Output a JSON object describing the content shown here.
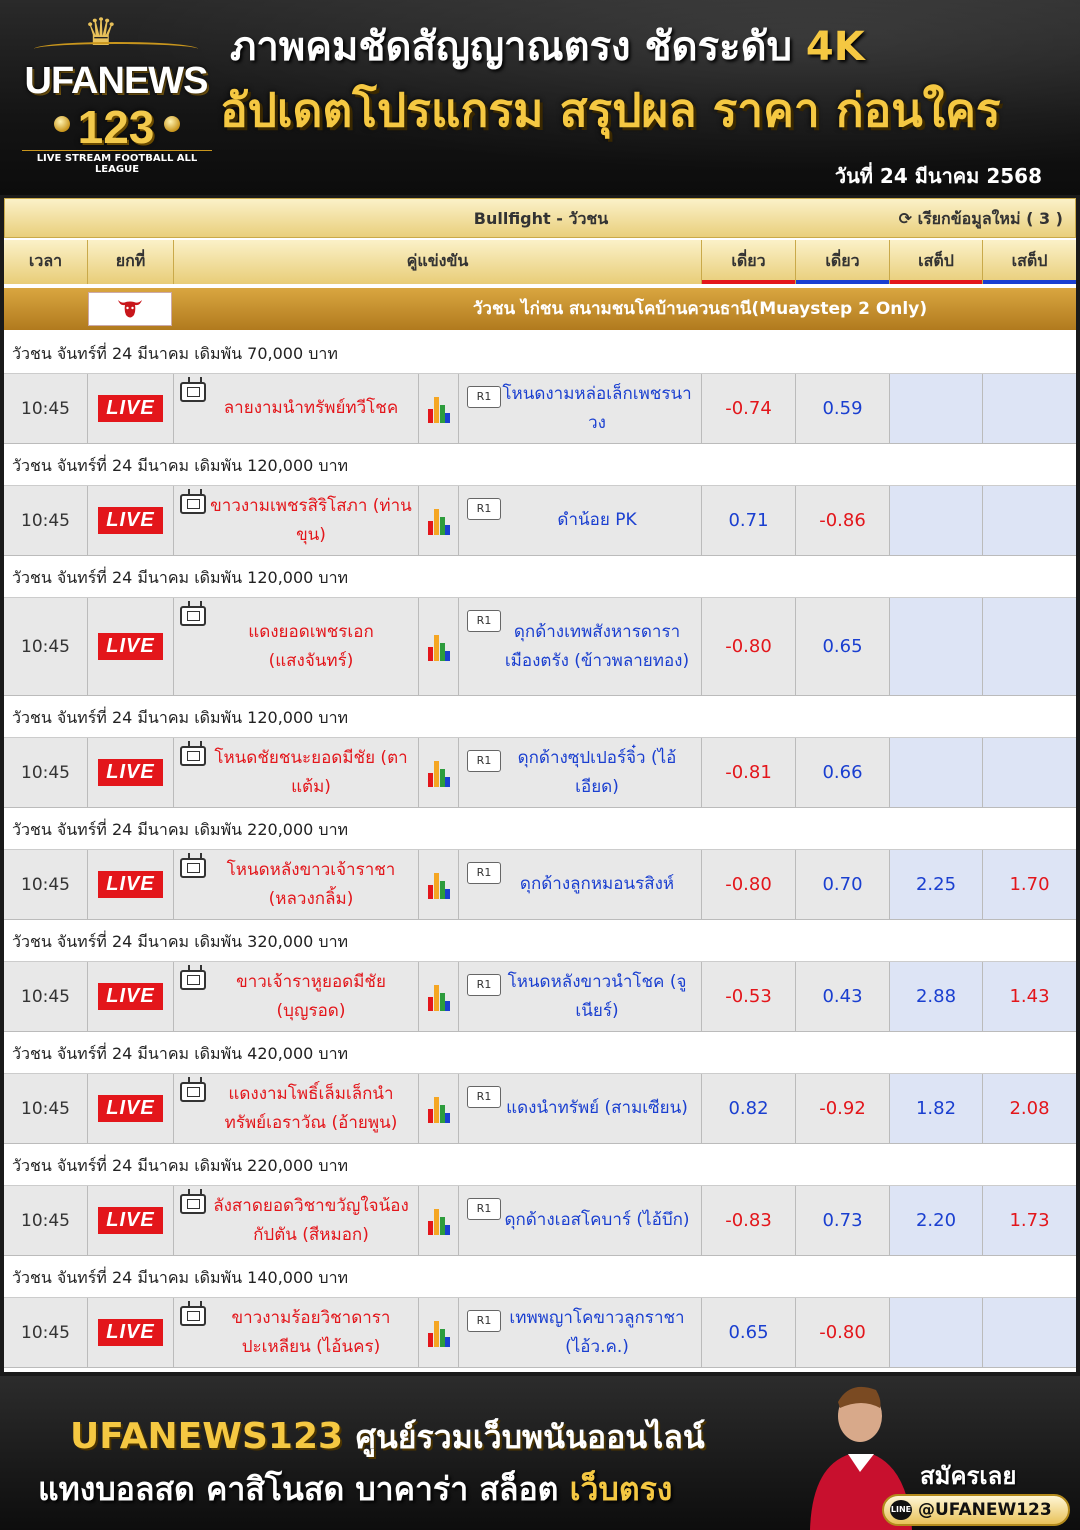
{
  "header": {
    "logo_main": "UFANEWS",
    "logo_number": "123",
    "logo_tagline": "LIVE STREAM FOOTBALL ALL LEAGUE",
    "headline_line1_a": "ภาพคมชัดสัญญาณตรง ชัดระดับ ",
    "headline_line1_b": "4K",
    "headline_line2": "อัปเดตโปรแกรม สรุปผล ราคา ก่อนใคร",
    "date": "วันที่ 24 มีนาคม 2568"
  },
  "table": {
    "title": "Bullfight - วัวชน",
    "refresh_label": "เรียกข้อมูลใหม่ ( 3 )",
    "columns": {
      "time": "เวลา",
      "round": "ยกที่",
      "matchup": "คู่แข่งขัน",
      "odd1": "เดี่ยว",
      "odd2": "เดี่ยว",
      "odd3": "เสต็ป",
      "odd4": "เสต็ป"
    },
    "league": "วัวชน ไก่ชน สนามชนโคบ้านควนธานี(Muaystep 2 Only)",
    "live_label": "LIVE",
    "round_label": "R1",
    "matches": [
      {
        "bet": "วัวชน จันทร์ที่ 24 มีนาคม เดิมพัน 70,000 บาท",
        "time": "10:45",
        "home": "ลายงามนำทรัพย์ทวีโชค",
        "away": "โหนดงามหล่อเล็กเพชรนาวง",
        "odd1": "-0.74",
        "odd2": "0.59",
        "odd3": "",
        "odd4": ""
      },
      {
        "bet": "วัวชน จันทร์ที่ 24 มีนาคม เดิมพัน 120,000 บาท",
        "time": "10:45",
        "home": "ขาวงามเพชรสิริโสภา (ท่านขุน)",
        "away": "ดำน้อย PK",
        "odd1": "0.71",
        "odd2": "-0.86",
        "odd3": "",
        "odd4": ""
      },
      {
        "bet": "วัวชน จันทร์ที่ 24 มีนาคม เดิมพัน 120,000 บาท",
        "time": "10:45",
        "home": "แดงยอดเพชรเอก (แสงจันทร์)",
        "away": "ดุกด้างเทพสังหารดาราเมืองตรัง (ข้าวพลายทอง)",
        "odd1": "-0.80",
        "odd2": "0.65",
        "odd3": "",
        "odd4": ""
      },
      {
        "bet": "วัวชน จันทร์ที่ 24 มีนาคม เดิมพัน 120,000 บาท",
        "time": "10:45",
        "home": "โหนดชัยชนะยอดมีชัย (ตาแต้ม)",
        "away": "ดุกด้างซุปเปอร์จิ๋ว (ไอ้เอียด)",
        "odd1": "-0.81",
        "odd2": "0.66",
        "odd3": "",
        "odd4": ""
      },
      {
        "bet": "วัวชน จันทร์ที่ 24 มีนาคม เดิมพัน 220,000 บาท",
        "time": "10:45",
        "home": "โหนดหลังขาวเจ้าราชา (หลวงกลิ้ม)",
        "away": "ดุกด้างลูกหมอนรสิงห์",
        "odd1": "-0.80",
        "odd2": "0.70",
        "odd3": "2.25",
        "odd4": "1.70"
      },
      {
        "bet": "วัวชน จันทร์ที่ 24 มีนาคม เดิมพัน 320,000 บาท",
        "time": "10:45",
        "home": "ขาวเจ้าราหูยอดมีชัย (บุญรอด)",
        "away": "โหนดหลังขาวนำโชค (จูเนียร์)",
        "odd1": "-0.53",
        "odd2": "0.43",
        "odd3": "2.88",
        "odd4": "1.43"
      },
      {
        "bet": "วัวชน จันทร์ที่ 24 มีนาคม เดิมพัน 420,000 บาท",
        "time": "10:45",
        "home": "แดงงามโพธิ์เล็มเล็กนำทรัพย์เอราวัณ (อ้ายพูน)",
        "away": "แดงนำทรัพย์ (สามเซียน)",
        "odd1": "0.82",
        "odd2": "-0.92",
        "odd3": "1.82",
        "odd4": "2.08"
      },
      {
        "bet": "วัวชน จันทร์ที่ 24 มีนาคม เดิมพัน 220,000 บาท",
        "time": "10:45",
        "home": "ลังสาดยอดวิชาขวัญใจน้องกัปตัน (สีหมอก)",
        "away": "ดุกด้างเอสโคบาร์ (ไอ้บึก)",
        "odd1": "-0.83",
        "odd2": "0.73",
        "odd3": "2.20",
        "odd4": "1.73"
      },
      {
        "bet": "วัวชน จันทร์ที่ 24 มีนาคม เดิมพัน 140,000 บาท",
        "time": "10:45",
        "home": "ขาวงามร้อยวิชาดาราปะเหลียน (ไอ้นคร)",
        "away": "เทพพญาโคขาวลูกราชา (ไอ้ว.ค.)",
        "odd1": "0.65",
        "odd2": "-0.80",
        "odd3": "",
        "odd4": ""
      }
    ]
  },
  "footer": {
    "brand": "UFANEWS123",
    "brand_tagline": "ศูนย์รวมเว็บพนันออนไลน์",
    "line2_a": "แทงบอลสด คาสิโนสด บาคาร่า สล็อต ",
    "line2_b": "เว็บตรง",
    "signup": "สมัครเลย",
    "line_id": "@UFANEW123",
    "line_icon_text": "LINE"
  },
  "colors": {
    "gold": "#f5c842",
    "red": "#e3161b",
    "blue": "#1a3fd0",
    "step_bg": "#dde4f5"
  }
}
